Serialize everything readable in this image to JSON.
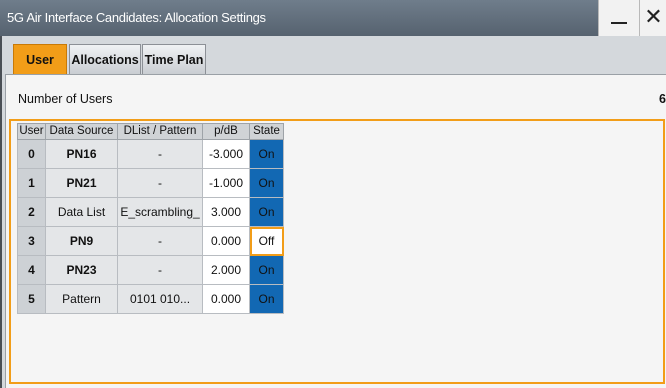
{
  "window": {
    "title": "5G Air Interface Candidates: Allocation Settings",
    "minimize_glyph": "",
    "close_glyph": "✕"
  },
  "tabs": [
    {
      "label": "User",
      "active": true
    },
    {
      "label": "Allocations",
      "active": false
    },
    {
      "label": "Time Plan",
      "active": false
    }
  ],
  "number_of_users": {
    "label": "Number of Users",
    "value": "6"
  },
  "table": {
    "headers": [
      "User",
      "Data Source",
      "DList / Pattern",
      "p/dB",
      "State"
    ],
    "rows": [
      {
        "user": "0",
        "data_source": "PN16",
        "dlist_pattern": "-",
        "power": "-3.000",
        "state": "On"
      },
      {
        "user": "1",
        "data_source": "PN21",
        "dlist_pattern": "-",
        "power": "-1.000",
        "state": "On"
      },
      {
        "user": "2",
        "data_source": "Data List",
        "dlist_pattern": "E_scrambling_",
        "power": "3.000",
        "state": "On"
      },
      {
        "user": "3",
        "data_source": "PN9",
        "dlist_pattern": "-",
        "power": "0.000",
        "state": "Off"
      },
      {
        "user": "4",
        "data_source": "PN23",
        "dlist_pattern": "-",
        "power": "2.000",
        "state": "On"
      },
      {
        "user": "5",
        "data_source": "Pattern",
        "dlist_pattern": "0101 010...",
        "power": "0.000",
        "state": "On"
      }
    ]
  },
  "colors": {
    "accent_orange": "#f29d18",
    "state_on_blue": "#1268b3",
    "titlebar": "#5f6b78"
  }
}
